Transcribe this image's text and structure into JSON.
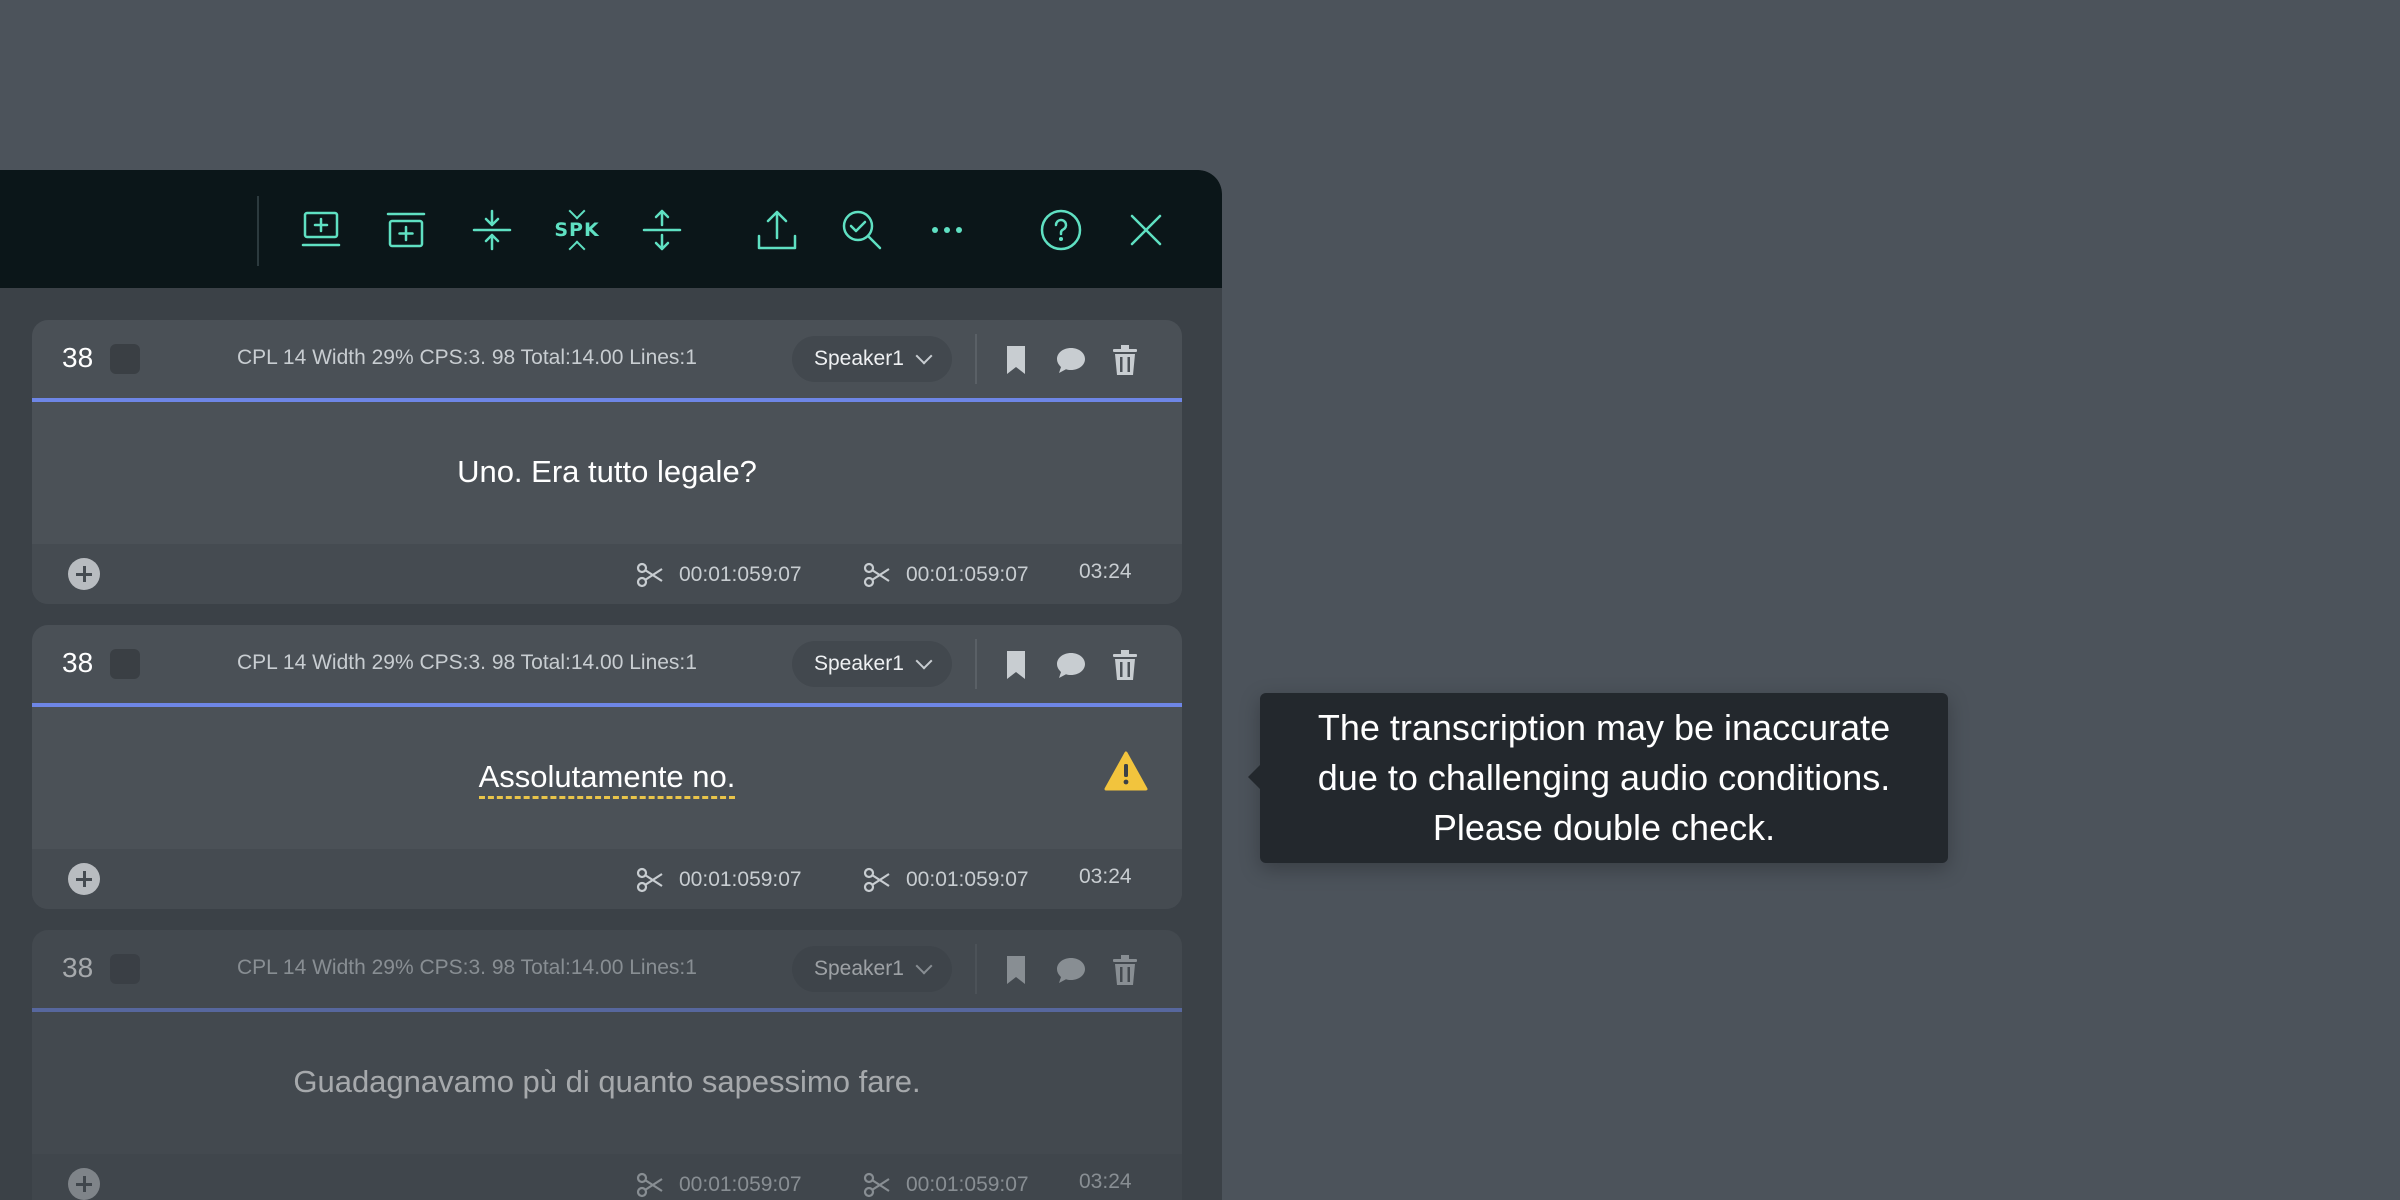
{
  "toolbar": {
    "buttons": [
      {
        "name": "insert-subtitle-icon"
      },
      {
        "name": "insert-gap-icon"
      },
      {
        "name": "merge-icon"
      },
      {
        "name": "speaker-merge",
        "label": "SPK"
      },
      {
        "name": "split-icon"
      },
      {
        "name": "export-icon"
      },
      {
        "name": "quality-check-icon"
      },
      {
        "name": "more-icon"
      },
      {
        "name": "help-icon"
      },
      {
        "name": "close-icon"
      }
    ]
  },
  "cards": [
    {
      "index": "38",
      "stats": "CPL 14 Width 29% CPS:3. 98 Total:14.00 Lines:1",
      "speaker": "Speaker1",
      "text": "Uno. Era tutto legale?",
      "tc_in": "00:01:059:07",
      "tc_out": "00:01:059:07",
      "duration": "03:24"
    },
    {
      "index": "38",
      "stats": "CPL 14 Width 29% CPS:3. 98 Total:14.00 Lines:1",
      "speaker": "Speaker1",
      "text": "Assolutamente no.",
      "tc_in": "00:01:059:07",
      "tc_out": "00:01:059:07",
      "duration": "03:24"
    },
    {
      "index": "38",
      "stats": "CPL 14 Width 29% CPS:3. 98 Total:14.00 Lines:1",
      "speaker": "Speaker1",
      "text": "Guadagnavamo pù di quanto sapessimo fare.",
      "tc_in": "00:01:059:07",
      "tc_out": "00:01:059:07",
      "duration": "03:24"
    }
  ],
  "tooltip": {
    "line1": "The transcription may be inaccurate",
    "line2": "due to challenging audio conditions.",
    "line3": "Please double check."
  },
  "colors": {
    "accent": "#5fe0c2",
    "blue_line": "#6e86e6",
    "warning": "#f2c43d"
  }
}
